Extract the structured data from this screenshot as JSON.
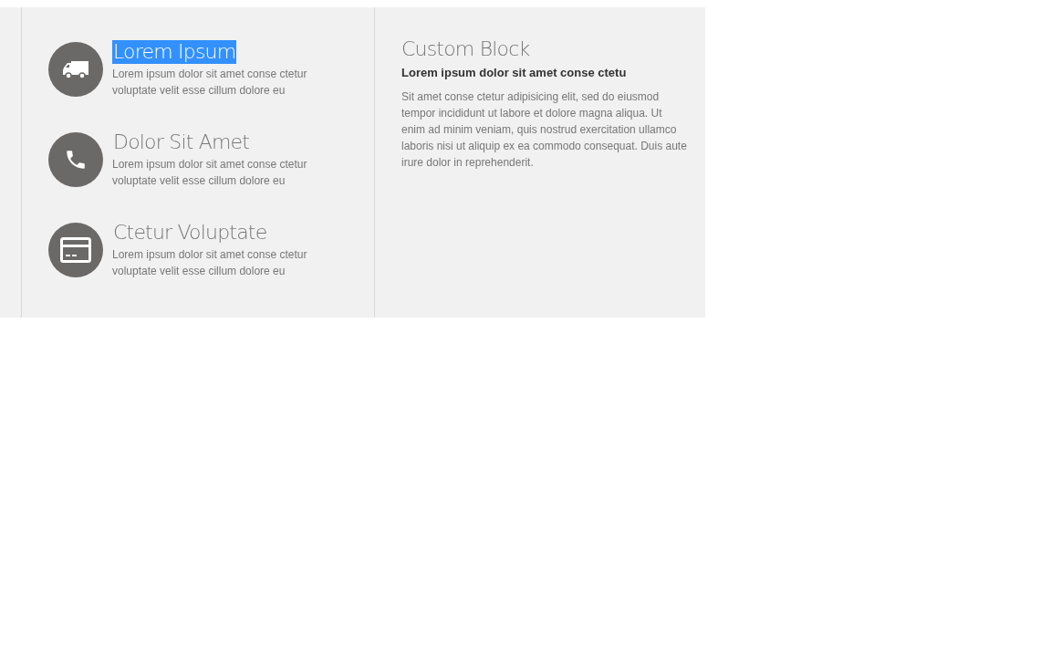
{
  "features": [
    {
      "kind": "truck",
      "title": "Lorem Ipsum",
      "title_selected": true,
      "text": "Lorem ipsum dolor sit amet conse ctetur voluptate velit esse cillum dolore eu"
    },
    {
      "kind": "phone",
      "title": "Dolor Sit Amet",
      "title_selected": false,
      "text": "Lorem ipsum dolor sit amet conse ctetur voluptate velit esse cillum dolore eu"
    },
    {
      "kind": "card",
      "title": "Ctetur Voluptate",
      "title_selected": false,
      "text": "Lorem ipsum dolor sit amet conse ctetur voluptate velit esse cillum dolore eu"
    }
  ],
  "custom_block": {
    "title": "Custom Block",
    "subtitle": "Lorem ipsum dolor sit amet conse ctetu",
    "text": "Sit amet conse ctetur adipisicing elit, sed do eiusmod tempor incididunt ut labore et dolore magna aliqua. Ut enim ad minim veniam, quis nostrud exercitation ullamco laboris nisi ut aliquip ex ea commodo consequat. Duis aute irure dolor in reprehenderit."
  }
}
